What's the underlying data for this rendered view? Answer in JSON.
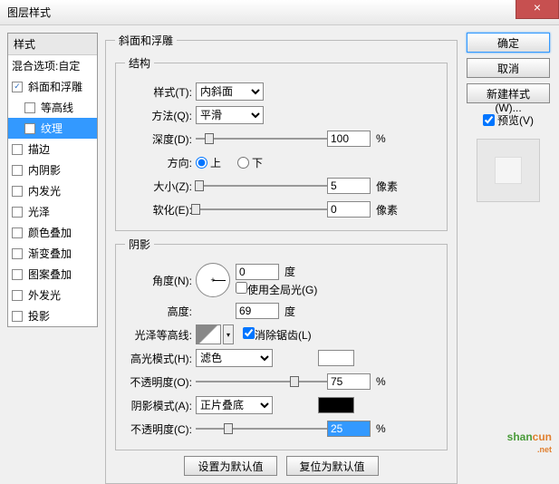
{
  "title": "图层样式",
  "styles_header": "样式",
  "blend_options": "混合选项:自定",
  "style_items": [
    {
      "label": "斜面和浮雕",
      "checked": true,
      "selected": false
    },
    {
      "label": "等高线",
      "checked": false,
      "selected": false,
      "sub": true
    },
    {
      "label": "纹理",
      "checked": false,
      "selected": true,
      "sub": true
    },
    {
      "label": "描边",
      "checked": false
    },
    {
      "label": "内阴影",
      "checked": false
    },
    {
      "label": "内发光",
      "checked": false
    },
    {
      "label": "光泽",
      "checked": false
    },
    {
      "label": "颜色叠加",
      "checked": false
    },
    {
      "label": "渐变叠加",
      "checked": false
    },
    {
      "label": "图案叠加",
      "checked": false
    },
    {
      "label": "外发光",
      "checked": false
    },
    {
      "label": "投影",
      "checked": false
    }
  ],
  "panel": {
    "title": "斜面和浮雕",
    "struct": {
      "legend": "结构",
      "style_lbl": "样式(T):",
      "style_val": "内斜面",
      "tech_lbl": "方法(Q):",
      "tech_val": "平滑",
      "depth_lbl": "深度(D):",
      "depth_val": "100",
      "depth_unit": "%",
      "dir_lbl": "方向:",
      "dir_up": "上",
      "dir_down": "下",
      "size_lbl": "大小(Z):",
      "size_val": "5",
      "size_unit": "像素",
      "soften_lbl": "软化(E):",
      "soften_val": "0",
      "soften_unit": "像素"
    },
    "shade": {
      "legend": "阴影",
      "angle_lbl": "角度(N):",
      "angle_val": "0",
      "angle_unit": "度",
      "global_lbl": "使用全局光(G)",
      "alt_lbl": "高度:",
      "alt_val": "69",
      "alt_unit": "度",
      "gloss_lbl": "光泽等高线:",
      "aa_lbl": "消除锯齿(L)",
      "hi_mode_lbl": "高光模式(H):",
      "hi_mode_val": "滤色",
      "hi_op_lbl": "不透明度(O):",
      "hi_op_val": "75",
      "hi_op_unit": "%",
      "sh_mode_lbl": "阴影模式(A):",
      "sh_mode_val": "正片叠底",
      "sh_op_lbl": "不透明度(C):",
      "sh_op_val": "25",
      "sh_op_unit": "%"
    }
  },
  "btns": {
    "default": "设置为默认值",
    "reset": "复位为默认值",
    "ok": "确定",
    "cancel": "取消",
    "newstyle": "新建样式(W)...",
    "preview": "预览(V)"
  }
}
